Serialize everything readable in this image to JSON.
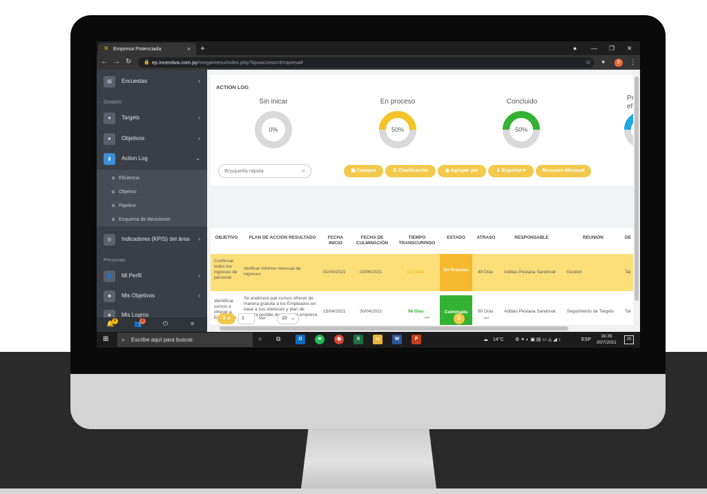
{
  "browser": {
    "tab_title": "Empresa Potenciada",
    "new_tab": "+",
    "url_host": "ep.incentiva.com.py",
    "url_path": "/megamenu/index.php?tipoacceso=Empresa#",
    "profile_initial": "9"
  },
  "sidebar": {
    "encuestas": "Encuestas",
    "section_gestion": "Gestión",
    "targets": "Targets",
    "objetivos": "Objetivos",
    "action_log": "Action Log",
    "sub": [
      "Eficiencia",
      "Objetivo",
      "Pipeline",
      "Esquema de Reuniones"
    ],
    "kpis": "Indicadores (KPIS) del área",
    "section_personas": "Personas",
    "mi_perfil": "Mi Perfil",
    "mis_objetivos": "Mis Objetivos",
    "mis_logros": "Mis Logros",
    "badge1": "6",
    "badge2": "2"
  },
  "actionlog": {
    "title": "ACTION LOG",
    "stats": [
      {
        "label": "Sin inicar",
        "value": "0%",
        "percent": 0,
        "color": "#d9d9d9"
      },
      {
        "label": "En proceso",
        "value": "50%",
        "percent": 50,
        "color": "#f5c428"
      },
      {
        "label": "Concluido",
        "value": "50%",
        "percent": 50,
        "color": "#34b233"
      },
      {
        "label": "Pr ef",
        "value": "",
        "percent": 50,
        "color": "#1ea7e4"
      }
    ],
    "search_placeholder": "Búsqueda rápida",
    "buttons": {
      "campos": "Campos",
      "clasificacion": "Clasificación",
      "agrupar": "Agrupar por",
      "exportar": "Exportar",
      "resumen": "Resumen Mensual"
    }
  },
  "table": {
    "headers": [
      "OBJETIVO",
      "PLAN DE ACCIÓN RESULTADO",
      "FECHA INICIO",
      "FECHA DE CULMINACIÓN",
      "TIEMPO TRANSCURRIDO",
      "ESTADO",
      "ATRASO",
      "RESPONSABLE",
      "REUNIÓN",
      "DE"
    ],
    "rows": [
      {
        "objetivo": "Confirmar todos los ingresos de personal",
        "plan": "Verificar informe mensual de ingresos",
        "inicio": "01/04/2021",
        "culminacion": "02/06/2021",
        "transcurrido": "111 Días",
        "estado": "En Proceso",
        "atraso": "48 Días",
        "responsable": "Addias Pestana Sandoval",
        "reunion": "Gestión",
        "de": "Tal"
      },
      {
        "objetivo": "Identificar cursos a ofrecer a Empleados",
        "plan": "Se analizará qué cursos ofrecer de manera gratuita a los Empleados en base a sus intereses y plan de carrera posible dentro de la empresa",
        "inicio": "15/04/2021",
        "culminacion": "30/04/2021",
        "transcurrido": "96 Días",
        "estado": "Culminada",
        "atraso": "80 Días",
        "responsable": "Addias Pestana Sandoval",
        "reunion": "Seguimiento de Targets",
        "de": "Tal"
      }
    ]
  },
  "pager": {
    "go_label": "Ir a",
    "page_input": "1",
    "ver_label": "Ver",
    "per_page": "10",
    "current": "1"
  },
  "taskbar": {
    "search_placeholder": "Escribe aquí para buscar.",
    "weather": "14°C",
    "lang": "ESP",
    "time": "16:39",
    "date": "20/7/2021",
    "notif": "20"
  }
}
